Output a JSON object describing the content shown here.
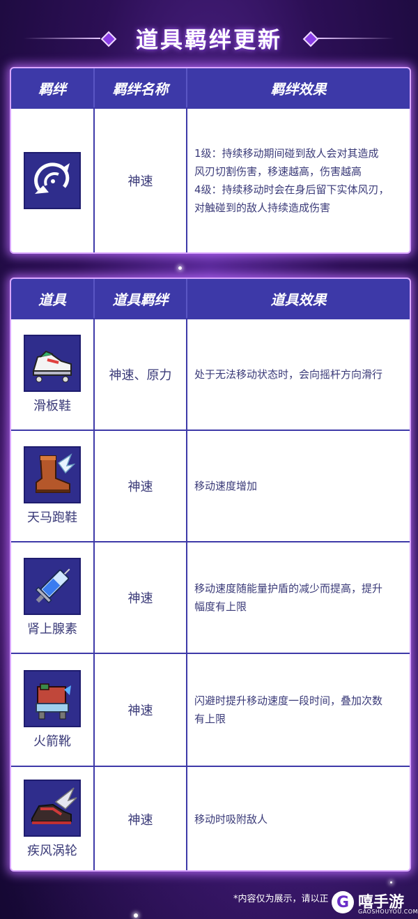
{
  "page_title": "道具羁绊更新",
  "bond_table": {
    "headers": [
      "羁绊",
      "羁绊名称",
      "羁绊效果"
    ],
    "rows": [
      {
        "icon": "wind-spiral-icon",
        "name": "神速",
        "effect_lines": [
          "1级：持续移动期间碰到敌人会对其造成",
          "风刃切割伤害，移速越高，伤害越高",
          "4级：持续移动时会在身后留下实体风刃，",
          "对触碰到的敌人持续造成伤害"
        ]
      }
    ]
  },
  "item_table": {
    "headers": [
      "道具",
      "道具羁绊",
      "道具效果"
    ],
    "rows": [
      {
        "icon": "skateboard-shoe-icon",
        "item": "滑板鞋",
        "bond": "神速、原力",
        "effect_lines": [
          "处于无法移动状态时，会向摇杆方向滑行"
        ]
      },
      {
        "icon": "winged-boot-icon",
        "item": "天马跑鞋",
        "bond": "神速",
        "effect_lines": [
          "移动速度增加"
        ]
      },
      {
        "icon": "syringe-icon",
        "item": "肾上腺素",
        "bond": "神速",
        "effect_lines": [
          "移动速度随能量护盾的减少而提高，提升",
          "幅度有上限"
        ]
      },
      {
        "icon": "rocket-boot-icon",
        "item": "火箭靴",
        "bond": "神速",
        "effect_lines": [
          "闪避时提升移动速度一段时间，叠加次数",
          "有上限"
        ]
      },
      {
        "icon": "turbo-wing-shoe-icon",
        "item": "疾风涡轮",
        "bond": "神速",
        "effect_lines": [
          "移动时吸附敌人"
        ]
      }
    ]
  },
  "footer": {
    "note": "*内容仅为展示，请以正",
    "logo_cn": "嘻手游",
    "logo_en": "GAOSHOUYOU.COM",
    "logo_mark": "G"
  },
  "colors": {
    "header_bg": "#3d39a8",
    "icon_bg": "#2f2d8c",
    "text": "#3a3a78",
    "glow": "#d9a6ff"
  }
}
